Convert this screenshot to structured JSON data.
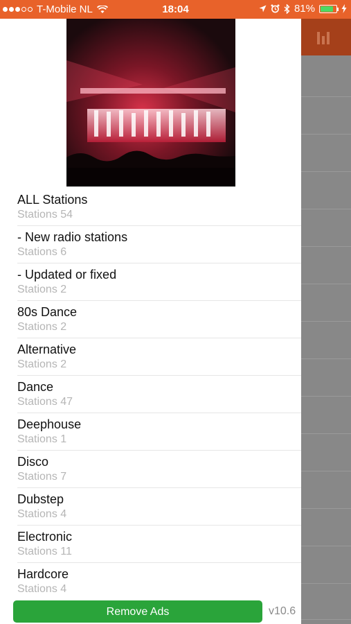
{
  "status_bar": {
    "carrier": "T-Mobile NL",
    "time": "18:04",
    "battery_percent": "81%",
    "battery_level": 0.81,
    "signal_bars_filled": 3,
    "signal_bars_total": 5,
    "icons": [
      "signal-dots-icon",
      "wifi-icon",
      "location-arrow-icon",
      "alarm-icon",
      "bluetooth-icon",
      "battery-icon",
      "charging-bolt-icon"
    ],
    "colors": {
      "background": "#e8622a",
      "battery_fill": "#4cd964"
    }
  },
  "side_header": {
    "icon": "equalizer-icon",
    "color": "#a5401a"
  },
  "genres": [
    {
      "title": "ALL Stations",
      "subtitle": "Stations 54"
    },
    {
      "title": "- New radio stations",
      "subtitle": "Stations 6"
    },
    {
      "title": "- Updated or fixed",
      "subtitle": "Stations 2"
    },
    {
      "title": "80s Dance",
      "subtitle": "Stations 2"
    },
    {
      "title": "Alternative",
      "subtitle": "Stations 2"
    },
    {
      "title": "Dance",
      "subtitle": "Stations 47"
    },
    {
      "title": "Deephouse",
      "subtitle": "Stations 1"
    },
    {
      "title": "Disco",
      "subtitle": "Stations 7"
    },
    {
      "title": "Dubstep",
      "subtitle": "Stations 4"
    },
    {
      "title": "Electronic",
      "subtitle": "Stations 11"
    },
    {
      "title": "Hardcore",
      "subtitle": "Stations 4"
    }
  ],
  "footer": {
    "remove_ads_label": "Remove Ads",
    "version": "v10.6",
    "button_color": "#2aa43a"
  }
}
